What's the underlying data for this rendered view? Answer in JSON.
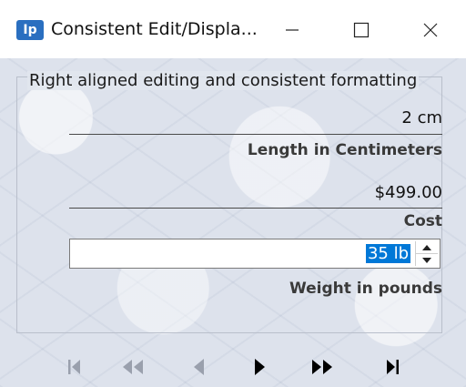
{
  "window": {
    "title": "Consistent Edit/Displa...",
    "icon_text": "Ip",
    "icon_color": "#2a6fc0"
  },
  "group": {
    "legend": "Right aligned editing and consistent formatting"
  },
  "fields": {
    "length_value": "2 cm",
    "length_label": "Length in Centimeters",
    "cost_value": "$499.00",
    "cost_label": "Cost",
    "weight_value": "35 lb",
    "weight_label": "Weight in pounds"
  },
  "colors": {
    "selection": "#0078d7",
    "nav_enabled": "#000000",
    "nav_disabled": "#9aa0ad"
  },
  "navigator": {
    "buttons": [
      {
        "name": "first-record",
        "icon": "first-icon",
        "enabled": false
      },
      {
        "name": "prior-page",
        "icon": "fast-back-icon",
        "enabled": false
      },
      {
        "name": "prior-record",
        "icon": "back-icon",
        "enabled": false
      },
      {
        "name": "next-record",
        "icon": "play-icon",
        "enabled": true
      },
      {
        "name": "next-page",
        "icon": "fast-forward-icon",
        "enabled": true
      },
      {
        "name": "last-record",
        "icon": "last-icon",
        "enabled": true
      }
    ]
  }
}
